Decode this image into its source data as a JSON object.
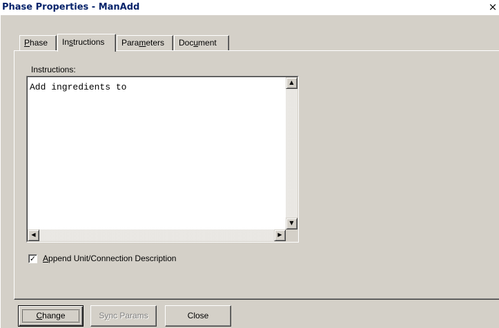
{
  "window": {
    "title": "Phase Properties - ManAdd",
    "close_glyph": "×"
  },
  "tabs": [
    {
      "label": "Phase",
      "accel_index": 0
    },
    {
      "label": "Instructions",
      "accel_index": 2
    },
    {
      "label": "Parameters",
      "accel_index": 4
    },
    {
      "label": "Document",
      "accel_index": 3
    }
  ],
  "active_tab": "Instructions",
  "instructions": {
    "label": "Instructions:",
    "text": "Add ingredients to"
  },
  "append_checkbox": {
    "label": "Append Unit/Connection Description",
    "checked": true
  },
  "buttons": {
    "change": "Change",
    "sync": "Sync Params",
    "close": "Close"
  },
  "icons": {
    "close": "close-icon",
    "scroll_up": "arrow-up-icon",
    "scroll_down": "arrow-down-icon",
    "scroll_left": "arrow-left-icon",
    "scroll_right": "arrow-right-icon",
    "check": "checkmark-icon"
  }
}
